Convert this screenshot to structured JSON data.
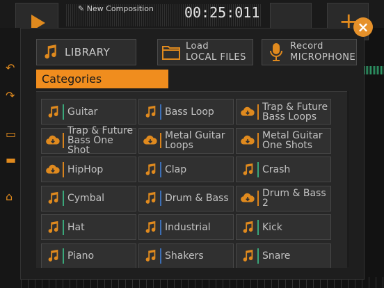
{
  "header": {
    "composition_name": "New Composition",
    "time": "00:25:011"
  },
  "modal": {
    "close_label": "×",
    "library_label": "LIBRARY",
    "load_label_1": "Load",
    "load_label_2": "LOCAL FILES",
    "record_label_1": "Record",
    "record_label_2": "MICROPHONE",
    "categories_title": "Categories"
  },
  "colors": {
    "accent": "#f08d1e",
    "panel": "#272727",
    "tile": "#303030"
  },
  "categories": [
    {
      "label": "Guitar",
      "icon": "music-note-icon",
      "sep": "g"
    },
    {
      "label": "Bass Loop",
      "icon": "music-note-icon",
      "sep": "b"
    },
    {
      "label": "Trap & Future Bass Loops",
      "icon": "cloud-download-icon",
      "sep": "o"
    },
    {
      "label": "Trap & Future Bass One Shot",
      "icon": "cloud-download-icon",
      "sep": "o"
    },
    {
      "label": "Metal Guitar Loops",
      "icon": "cloud-download-icon",
      "sep": "o"
    },
    {
      "label": "Metal Guitar One Shots",
      "icon": "cloud-download-icon",
      "sep": "o"
    },
    {
      "label": "HipHop",
      "icon": "cloud-download-icon",
      "sep": "o"
    },
    {
      "label": "Clap",
      "icon": "music-note-icon",
      "sep": "b"
    },
    {
      "label": "Crash",
      "icon": "music-note-icon",
      "sep": "g"
    },
    {
      "label": "Cymbal",
      "icon": "music-note-icon",
      "sep": "g"
    },
    {
      "label": "Drum & Bass",
      "icon": "music-note-icon",
      "sep": "b"
    },
    {
      "label": "Drum & Bass 2",
      "icon": "cloud-download-icon",
      "sep": "o"
    },
    {
      "label": "Hat",
      "icon": "music-note-icon",
      "sep": "g"
    },
    {
      "label": "Industrial",
      "icon": "music-note-icon",
      "sep": "b"
    },
    {
      "label": "Kick",
      "icon": "music-note-icon",
      "sep": "g"
    },
    {
      "label": "Piano",
      "icon": "music-note-icon",
      "sep": "g"
    },
    {
      "label": "Shakers",
      "icon": "music-note-icon",
      "sep": "b"
    },
    {
      "label": "Snare",
      "icon": "music-note-icon",
      "sep": "g"
    }
  ]
}
